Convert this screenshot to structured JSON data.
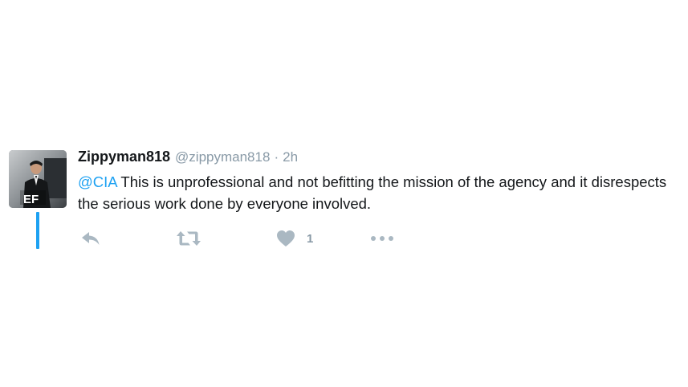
{
  "tweet": {
    "author": {
      "display_name": "Zippyman818",
      "handle": "@zippyman818",
      "avatar_monogram": "EF"
    },
    "separator": "·",
    "timestamp": "2h",
    "mention": "@CIA",
    "body": " This is unprofessional and not befitting the mission of the agency and it disrespects the serious work done by everyone involved.",
    "actions": {
      "reply_icon": "reply-icon",
      "retweet_icon": "retweet-icon",
      "like_icon": "heart-icon",
      "like_count": "1",
      "more_icon": "more-dots-icon"
    }
  },
  "colors": {
    "accent": "#1da1f2",
    "text": "#14171a",
    "muted": "#8899a6",
    "icon": "#aab8c2"
  }
}
